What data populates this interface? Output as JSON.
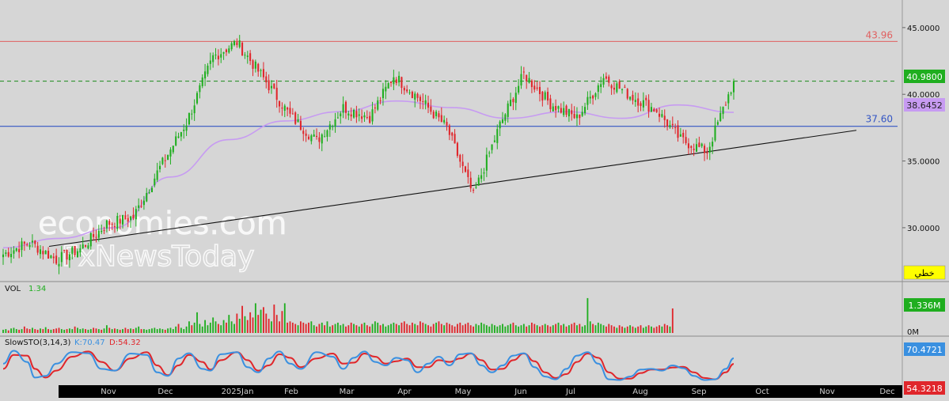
{
  "chart_data": [
    {
      "type": "candlestick",
      "name": "price",
      "y_axis_ticks": [
        "45.0000",
        "40.0000",
        "35.0000",
        "30.0000"
      ],
      "ylim": [
        26.2,
        46.0
      ],
      "x_axis_labels": [
        "Nov",
        "Dec",
        "2025Jan",
        "Feb",
        "Mar",
        "Apr",
        "May",
        "Jun",
        "Jul",
        "Aug",
        "Sep",
        "Oct",
        "Nov",
        "Dec"
      ],
      "last_price_label": "40.9800",
      "ma_label": "38.6452",
      "ma_last": 38.6452,
      "resistance": {
        "value": 43.96,
        "label": "43.96"
      },
      "support": {
        "value": 37.6,
        "label": "37.60"
      },
      "current_line": 40.98,
      "trendline": {
        "from": [
          "Oct 30",
          28.6
        ],
        "to": [
          "Oct 10 (next yr)",
          37.3
        ]
      },
      "scale_badge": "خطي",
      "watermark": [
        "economies.com",
        "FxNewsToday"
      ],
      "price_keypoints": [
        [
          "Oct 2024",
          28.0
        ],
        [
          "late Oct",
          28.9
        ],
        [
          "early Nov",
          27.6
        ],
        [
          "mid Nov",
          28.4
        ],
        [
          "Dec",
          30.3
        ],
        [
          "early Jan",
          30.8
        ],
        [
          "mid Jan",
          34.5
        ],
        [
          "late Jan",
          37.9
        ],
        [
          "early Feb",
          42.8
        ],
        [
          "Feb high",
          43.9
        ],
        [
          "late Feb",
          41.2
        ],
        [
          "Mar",
          38.4
        ],
        [
          "early Apr",
          36.5
        ],
        [
          "mid Apr",
          39.0
        ],
        [
          "late Apr",
          38.3
        ],
        [
          "May",
          41.4
        ],
        [
          "late May",
          39.6
        ],
        [
          "early Jun",
          37.5
        ],
        [
          "Jun low",
          32.4
        ],
        [
          "late Jun",
          37.7
        ],
        [
          "early Jul",
          41.5
        ],
        [
          "mid Jul",
          39.3
        ],
        [
          "late Jul",
          38.2
        ],
        [
          "Aug",
          41.3
        ],
        [
          "mid Aug",
          39.9
        ],
        [
          "late Aug",
          38.8
        ],
        [
          "early Sep",
          36.6
        ],
        [
          "Sep low",
          35.7
        ],
        [
          "last",
          40.98
        ]
      ],
      "ma_keypoints": [
        [
          "Oct 2024",
          28.5
        ],
        [
          "Dec",
          29.2
        ],
        [
          "early Jan",
          30.0
        ],
        [
          "late Jan",
          33.8
        ],
        [
          "mid Feb",
          36.6
        ],
        [
          "Mar",
          38.0
        ],
        [
          "Apr",
          38.7
        ],
        [
          "May",
          39.5
        ],
        [
          "Jun",
          39.0
        ],
        [
          "late Jun",
          38.2
        ],
        [
          "Jul",
          38.7
        ],
        [
          "Aug",
          38.2
        ],
        [
          "Sep",
          39.2
        ],
        [
          "last",
          38.6452
        ]
      ]
    },
    {
      "type": "bar",
      "name": "volume",
      "label": "VOL",
      "value_label": "1.34",
      "last_badge": "1.336M",
      "y_axis_ticks": [
        "0M"
      ],
      "ylim": [
        0,
        3.0
      ],
      "values": [
        0.25,
        0.3,
        0.2,
        0.35,
        0.4,
        0.3,
        0.25,
        0.3,
        0.5,
        0.35,
        0.3,
        0.4,
        0.3,
        0.25,
        0.35,
        0.3,
        0.45,
        0.3,
        0.25,
        0.3,
        0.35,
        0.4,
        0.3,
        0.25,
        0.3,
        0.35,
        0.3,
        0.5,
        0.4,
        0.3,
        0.35,
        0.3,
        0.25,
        0.3,
        0.4,
        0.35,
        0.3,
        0.25,
        0.35,
        0.6,
        0.4,
        0.3,
        0.35,
        0.3,
        0.25,
        0.3,
        0.4,
        0.3,
        0.35,
        0.3,
        0.4,
        0.5,
        0.3,
        0.3,
        0.25,
        0.3,
        0.35,
        0.4,
        0.3,
        0.35,
        0.3,
        0.25,
        0.35,
        0.4,
        0.3,
        0.5,
        0.7,
        0.4,
        0.3,
        0.5,
        0.9,
        0.6,
        0.8,
        1.6,
        0.7,
        0.5,
        1.0,
        0.6,
        0.8,
        1.2,
        0.9,
        0.7,
        0.6,
        1.0,
        0.8,
        1.4,
        0.9,
        0.7,
        1.5,
        1.1,
        2.1,
        1.3,
        1.0,
        1.6,
        1.2,
        2.3,
        1.4,
        1.8,
        2.0,
        1.5,
        1.1,
        0.9,
        2.2,
        1.4,
        0.9,
        1.7,
        2.3,
        0.8,
        0.9,
        0.8,
        0.7,
        0.6,
        0.9,
        0.8,
        0.7,
        0.8,
        0.9,
        0.6,
        0.5,
        0.7,
        0.8,
        0.6,
        0.9,
        0.5,
        0.6,
        0.7,
        0.8,
        0.6,
        0.7,
        0.5,
        0.6,
        0.8,
        0.7,
        0.6,
        0.5,
        0.7,
        0.8,
        0.6,
        0.5,
        0.7,
        0.9,
        0.8,
        0.6,
        0.7,
        0.5,
        0.6,
        0.7,
        0.8,
        0.7,
        0.6,
        0.8,
        0.9,
        0.7,
        0.6,
        0.8,
        0.7,
        0.6,
        0.9,
        0.8,
        0.7,
        0.6,
        0.5,
        0.7,
        0.8,
        0.9,
        0.7,
        0.6,
        0.8,
        0.7,
        0.6,
        0.5,
        0.7,
        0.8,
        0.6,
        0.7,
        0.8,
        0.6,
        0.5,
        0.7,
        0.6,
        0.8,
        0.7,
        0.6,
        0.5,
        0.7,
        0.6,
        0.5,
        0.6,
        0.7,
        0.5,
        0.6,
        0.7,
        0.8,
        0.6,
        0.5,
        0.6,
        0.7,
        0.5,
        0.6,
        0.8,
        0.7,
        0.6,
        0.5,
        0.6,
        0.7,
        0.6,
        0.5,
        0.6,
        0.7,
        0.8,
        0.6,
        0.7,
        0.5,
        0.6,
        0.7,
        0.8,
        0.6,
        0.7,
        0.5,
        0.6,
        2.7,
        0.9,
        0.7,
        0.6,
        0.8,
        0.7,
        0.6,
        0.5,
        0.7,
        0.6,
        0.5,
        0.4,
        0.6,
        0.5,
        0.4,
        0.5,
        0.6,
        0.5,
        0.4,
        0.5,
        0.6,
        0.4,
        0.5,
        0.6,
        0.5,
        0.4,
        0.5,
        0.6,
        0.5,
        0.7,
        0.6,
        0.5,
        1.9
      ]
    },
    {
      "type": "line",
      "name": "stochastic",
      "label": "SlowSTO(3,14,3)",
      "k_label": "K:70.47",
      "d_label": "D:54.32",
      "k_badge": "70.4721",
      "d_badge": "54.3218",
      "ylim": [
        0,
        100
      ],
      "k_keypoints": [
        [
          0,
          55
        ],
        [
          4,
          92
        ],
        [
          9,
          60
        ],
        [
          12,
          15
        ],
        [
          16,
          20
        ],
        [
          20,
          55
        ],
        [
          26,
          88
        ],
        [
          32,
          85
        ],
        [
          37,
          40
        ],
        [
          42,
          35
        ],
        [
          48,
          84
        ],
        [
          54,
          80
        ],
        [
          58,
          30
        ],
        [
          62,
          20
        ],
        [
          66,
          70
        ],
        [
          70,
          85
        ],
        [
          75,
          40
        ],
        [
          78,
          35
        ],
        [
          82,
          82
        ],
        [
          88,
          88
        ],
        [
          92,
          45
        ],
        [
          96,
          30
        ],
        [
          100,
          70
        ],
        [
          104,
          90
        ],
        [
          108,
          55
        ],
        [
          112,
          40
        ],
        [
          118,
          88
        ],
        [
          124,
          75
        ],
        [
          128,
          40
        ],
        [
          132,
          72
        ],
        [
          136,
          90
        ],
        [
          140,
          60
        ],
        [
          144,
          50
        ],
        [
          148,
          72
        ],
        [
          152,
          65
        ],
        [
          156,
          30
        ],
        [
          160,
          55
        ],
        [
          164,
          75
        ],
        [
          168,
          50
        ],
        [
          172,
          82
        ],
        [
          176,
          85
        ],
        [
          180,
          50
        ],
        [
          184,
          30
        ],
        [
          188,
          50
        ],
        [
          192,
          78
        ],
        [
          196,
          85
        ],
        [
          200,
          45
        ],
        [
          204,
          18
        ],
        [
          208,
          10
        ],
        [
          212,
          40
        ],
        [
          216,
          78
        ],
        [
          220,
          88
        ],
        [
          224,
          55
        ],
        [
          228,
          10
        ],
        [
          232,
          8
        ],
        [
          236,
          18
        ],
        [
          240,
          38
        ],
        [
          244,
          40
        ],
        [
          248,
          35
        ],
        [
          252,
          50
        ],
        [
          256,
          42
        ],
        [
          260,
          20
        ],
        [
          264,
          8
        ],
        [
          268,
          10
        ],
        [
          272,
          40
        ],
        [
          275,
          70.47
        ]
      ],
      "d_keypoints": [
        [
          0,
          40
        ],
        [
          4,
          80
        ],
        [
          9,
          78
        ],
        [
          12,
          40
        ],
        [
          16,
          15
        ],
        [
          20,
          35
        ],
        [
          26,
          75
        ],
        [
          32,
          90
        ],
        [
          37,
          60
        ],
        [
          42,
          35
        ],
        [
          48,
          70
        ],
        [
          54,
          88
        ],
        [
          58,
          50
        ],
        [
          62,
          22
        ],
        [
          66,
          50
        ],
        [
          70,
          80
        ],
        [
          75,
          60
        ],
        [
          78,
          38
        ],
        [
          82,
          65
        ],
        [
          88,
          88
        ],
        [
          92,
          65
        ],
        [
          96,
          35
        ],
        [
          100,
          50
        ],
        [
          104,
          82
        ],
        [
          108,
          72
        ],
        [
          112,
          45
        ],
        [
          118,
          70
        ],
        [
          124,
          84
        ],
        [
          128,
          55
        ],
        [
          132,
          58
        ],
        [
          136,
          84
        ],
        [
          140,
          75
        ],
        [
          144,
          55
        ],
        [
          148,
          62
        ],
        [
          152,
          70
        ],
        [
          156,
          45
        ],
        [
          160,
          45
        ],
        [
          164,
          65
        ],
        [
          168,
          60
        ],
        [
          172,
          70
        ],
        [
          176,
          84
        ],
        [
          180,
          65
        ],
        [
          184,
          38
        ],
        [
          188,
          40
        ],
        [
          192,
          65
        ],
        [
          196,
          84
        ],
        [
          200,
          62
        ],
        [
          204,
          30
        ],
        [
          208,
          14
        ],
        [
          212,
          25
        ],
        [
          216,
          60
        ],
        [
          220,
          84
        ],
        [
          224,
          72
        ],
        [
          228,
          30
        ],
        [
          232,
          12
        ],
        [
          236,
          12
        ],
        [
          240,
          28
        ],
        [
          244,
          38
        ],
        [
          248,
          38
        ],
        [
          252,
          44
        ],
        [
          256,
          46
        ],
        [
          260,
          30
        ],
        [
          264,
          14
        ],
        [
          268,
          10
        ],
        [
          272,
          30
        ],
        [
          275,
          54.32
        ]
      ]
    }
  ],
  "colors": {
    "background": "#d6d6d6",
    "up": "#1fae1f",
    "down": "#e0262b",
    "ma": "#c79bf2",
    "support": "#3355c4",
    "resistance": "#e06060",
    "current": "#1a8a1a",
    "k": "#3a90e0",
    "d": "#e0262b"
  }
}
